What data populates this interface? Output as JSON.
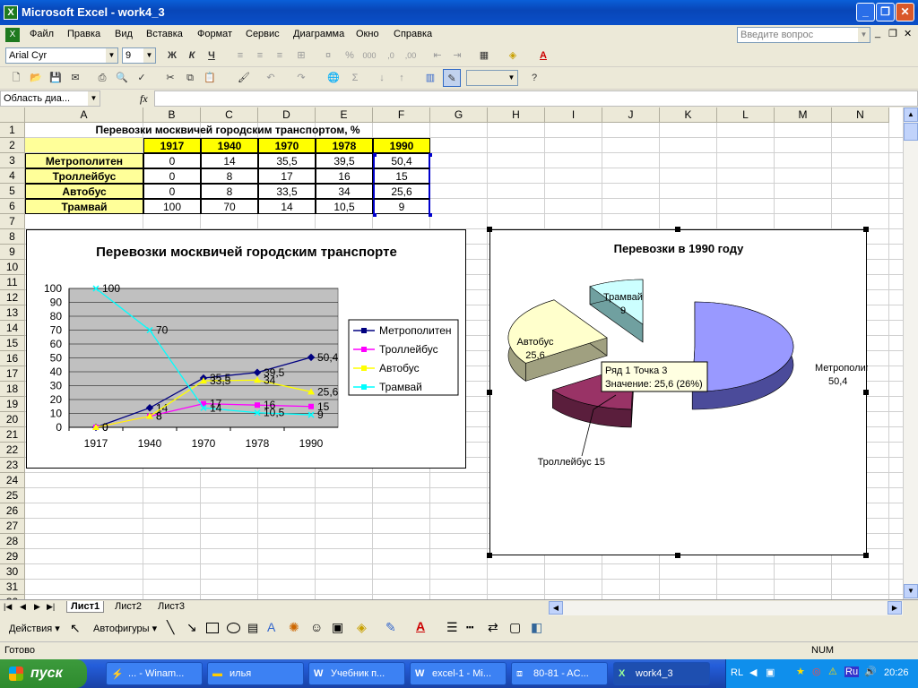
{
  "window": {
    "title": "Microsoft Excel - work4_3"
  },
  "menu": [
    "Файл",
    "Правка",
    "Вид",
    "Вставка",
    "Формат",
    "Сервис",
    "Диаграмма",
    "Окно",
    "Справка"
  ],
  "help_placeholder": "Введите вопрос",
  "font": {
    "name": "Arial Cyr",
    "size": "9"
  },
  "name_box": "Область диа...",
  "fx": "fx",
  "columns": [
    "A",
    "B",
    "C",
    "D",
    "E",
    "F",
    "G",
    "H",
    "I",
    "J",
    "K",
    "L",
    "M",
    "N"
  ],
  "rows": [
    "1",
    "2",
    "3",
    "4",
    "5",
    "6",
    "7",
    "8",
    "9",
    "10",
    "11",
    "12",
    "13",
    "14",
    "15",
    "16",
    "17",
    "18",
    "19",
    "20",
    "21",
    "22",
    "23",
    "24",
    "25",
    "26",
    "27",
    "28",
    "29",
    "30",
    "31",
    "32"
  ],
  "table": {
    "title": "Перевозки москвичей городским транспортом, %",
    "years": [
      "1917",
      "1940",
      "1970",
      "1978",
      "1990"
    ],
    "rows": [
      {
        "label": "Метрополитен",
        "values": [
          "0",
          "14",
          "35,5",
          "39,5",
          "50,4"
        ]
      },
      {
        "label": "Троллейбус",
        "values": [
          "0",
          "8",
          "17",
          "16",
          "15"
        ]
      },
      {
        "label": "Автобус",
        "values": [
          "0",
          "8",
          "33,5",
          "34",
          "25,6"
        ]
      },
      {
        "label": "Трамвай",
        "values": [
          "100",
          "70",
          "14",
          "10,5",
          "9"
        ]
      }
    ]
  },
  "chart_data": [
    {
      "type": "line",
      "title": "Перевозки москвичей городским транспорте",
      "categories": [
        "1917",
        "1940",
        "1970",
        "1978",
        "1990"
      ],
      "ylim": [
        0,
        100
      ],
      "yticks": [
        "0",
        "10",
        "20",
        "30",
        "40",
        "50",
        "60",
        "70",
        "80",
        "90",
        "100"
      ],
      "series": [
        {
          "name": "Метрополитен",
          "values": [
            0,
            14,
            35.5,
            39.5,
            50.4
          ],
          "labels": [
            "0",
            "14",
            "35,5",
            "39,5",
            "50,4"
          ],
          "color": "#000080"
        },
        {
          "name": "Троллейбус",
          "values": [
            0,
            8,
            17,
            16,
            15
          ],
          "labels": [
            "0",
            "8",
            "17",
            "16",
            "15"
          ],
          "color": "#ff00ff"
        },
        {
          "name": "Автобус",
          "values": [
            0,
            8,
            33.5,
            34,
            25.6
          ],
          "labels": [
            "0",
            "8",
            "33,5",
            "34",
            "25,6"
          ],
          "color": "#ffff00"
        },
        {
          "name": "Трамвай",
          "values": [
            100,
            70,
            14,
            10.5,
            9
          ],
          "labels": [
            "100",
            "70",
            "14",
            "10,5",
            "9"
          ],
          "color": "#00ffff"
        }
      ],
      "legend": "right",
      "grid": true
    },
    {
      "type": "pie",
      "title": "Перевозки в 1990 году",
      "slices": [
        {
          "name": "Метрополитен",
          "value": 50.4,
          "label": "50,4",
          "color": "#9999ff"
        },
        {
          "name": "Троллейбус",
          "value": 15,
          "label": "15",
          "color": "#993366"
        },
        {
          "name": "Автобус",
          "value": 25.6,
          "label": "25,6",
          "color": "#ffffcc"
        },
        {
          "name": "Трамвай",
          "value": 9,
          "label": "9",
          "color": "#ccffff"
        }
      ],
      "tooltip": {
        "line1": "Ряд 1 Точка 3",
        "line2": "Значение: 25,6 (26%)"
      }
    }
  ],
  "sheets": [
    "Лист1",
    "Лист2",
    "Лист3"
  ],
  "drawing": {
    "actions": "Действия",
    "autoshapes": "Автофигуры"
  },
  "status": {
    "left": "Готово",
    "num": "NUM"
  },
  "taskbar": {
    "start": "пуск",
    "tasks": [
      "... - Winam...",
      "илья",
      "Учебник п...",
      "excel-1 - Mi...",
      "80-81 - AC...",
      "work4_3"
    ],
    "lang": "RL",
    "time": "20:26"
  }
}
